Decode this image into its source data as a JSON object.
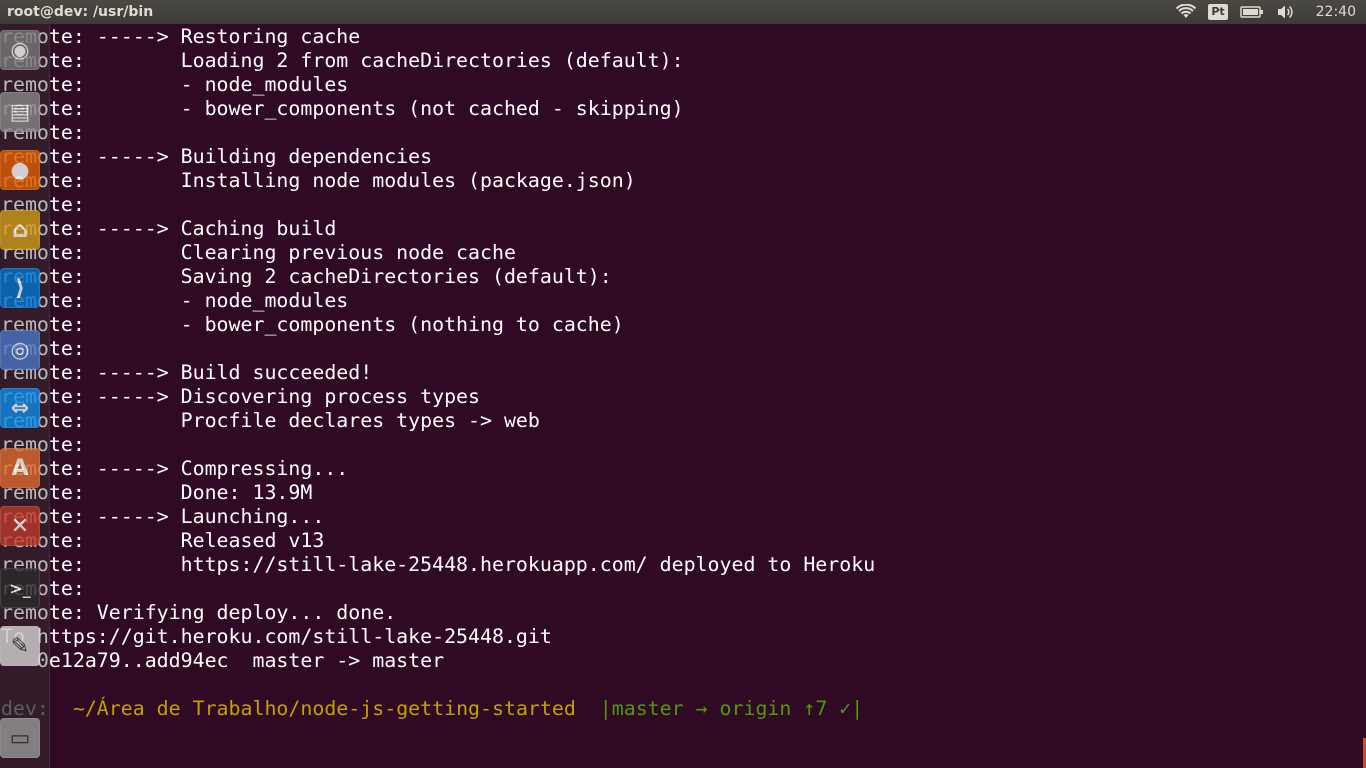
{
  "window": {
    "title": "root@dev: /usr/bin"
  },
  "tray": {
    "wifi_icon": "wifi-icon",
    "keyboard_layout": "Pt",
    "battery_icon": "battery-icon",
    "volume_icon": "volume-icon",
    "clock": "22:40"
  },
  "colors": {
    "terminal_bg": "#300a24",
    "text": "#ffffff",
    "prompt_host": "#6f6f6f",
    "prompt_path": "#c4a000",
    "prompt_git": "#4e9a06",
    "topbar": "#3c3b37"
  },
  "terminal": {
    "lines": [
      "remote: -----> Restoring cache",
      "remote:        Loading 2 from cacheDirectories (default):",
      "remote:        - node_modules",
      "remote:        - bower_components (not cached - skipping)",
      "remote:",
      "remote: -----> Building dependencies",
      "remote:        Installing node modules (package.json)",
      "remote:",
      "remote: -----> Caching build",
      "remote:        Clearing previous node cache",
      "remote:        Saving 2 cacheDirectories (default):",
      "remote:        - node_modules",
      "remote:        - bower_components (nothing to cache)",
      "remote:",
      "remote: -----> Build succeeded!",
      "remote: -----> Discovering process types",
      "remote:        Procfile declares types -> web",
      "remote:",
      "remote: -----> Compressing...",
      "remote:        Done: 13.9M",
      "remote: -----> Launching...",
      "remote:        Released v13",
      "remote:        https://still-lake-25448.herokuapp.com/ deployed to Heroku",
      "remote:",
      "remote: Verifying deploy... done.",
      "To https://git.heroku.com/still-lake-25448.git",
      "   0e12a79..add94ec  master -> master",
      ""
    ],
    "prompt": {
      "host": "dev:",
      "path": "~/Área de Trabalho/node-js-getting-started",
      "git": "|master → origin ↑7 ✓|"
    }
  },
  "launcher": {
    "items": [
      {
        "name": "ubuntu-logo-icon",
        "glyph": "◉",
        "color": "#7a7a7a"
      },
      {
        "name": "files-icon",
        "glyph": "▤",
        "color": "#8a8a8a"
      },
      {
        "name": "firefox-icon",
        "glyph": "●",
        "color": "#e66000"
      },
      {
        "name": "broom-icon",
        "glyph": "⌂",
        "color": "#d4a017"
      },
      {
        "name": "vscode-icon",
        "glyph": "⟩",
        "color": "#0078d4"
      },
      {
        "name": "chromium-icon",
        "glyph": "◎",
        "color": "#4a78c8"
      },
      {
        "name": "teamviewer-icon",
        "glyph": "⇔",
        "color": "#0e8ee9"
      },
      {
        "name": "software-center-icon",
        "glyph": "A",
        "color": "#e06b2b"
      },
      {
        "name": "system-settings-icon",
        "glyph": "✕",
        "color": "#c0392b"
      },
      {
        "name": "terminal-icon",
        "glyph": ">_",
        "color": "#2b2b2b"
      },
      {
        "name": "text-editor-icon",
        "glyph": "✎",
        "color": "#d8d8d8"
      },
      {
        "name": "trash-icon",
        "glyph": "▭",
        "color": "#9a9a9a"
      }
    ]
  }
}
